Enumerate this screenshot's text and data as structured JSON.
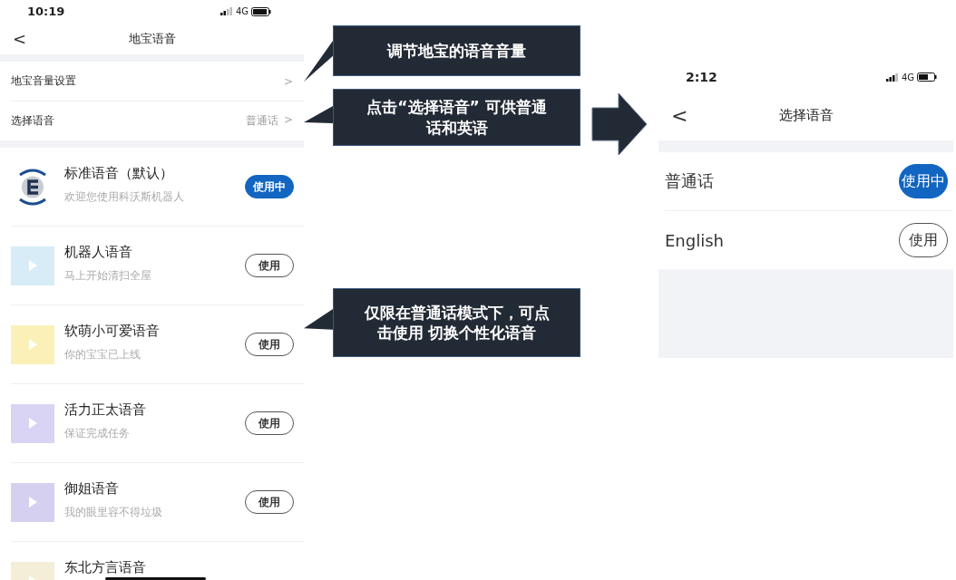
{
  "left_phone": {
    "status_bar": {
      "time": "10:19",
      "network": "4G"
    },
    "nav_bar": {
      "back": "<",
      "title": "地宝语音"
    },
    "settings": [
      {
        "label": "地宝音量设置",
        "chevron": ">"
      },
      {
        "label": "选择语音",
        "value": "普通话",
        "chevron": ">"
      }
    ],
    "voices": [
      {
        "kind": "logo",
        "title": "标准语音（默认）",
        "subtitle": "欢迎您使用科沃斯机器人",
        "button": "使用中",
        "selected": true
      },
      {
        "kind": "picture",
        "title": "机器人语音",
        "subtitle": "马上开始清扫全屋",
        "button": "使用",
        "selected": false
      },
      {
        "kind": "picture",
        "title": "软萌小可爱语音",
        "subtitle": "你的宝宝已上线",
        "button": "使用",
        "selected": false
      },
      {
        "kind": "picture",
        "title": "活力正太语音",
        "subtitle": "保证完成任务",
        "button": "使用",
        "selected": false
      },
      {
        "kind": "picture",
        "title": "御姐语音",
        "subtitle": "我的眼里容不得垃圾",
        "button": "使用",
        "selected": false
      },
      {
        "kind": "picture",
        "title": "东北方言语音"
      }
    ]
  },
  "callouts": [
    "调节地宝的语音音量",
    "点击“选择语音” 可供普通话和英语",
    "仅限在普通话模式下，可点击使用 切换个性化语音"
  ],
  "right_phone": {
    "status_bar": {
      "time": "2:12",
      "network": "4G"
    },
    "nav_bar": {
      "back": "<",
      "title": "选择语音"
    },
    "languages": [
      {
        "label": "普通话",
        "button": "使用中",
        "selected": true
      },
      {
        "label": "English",
        "button": "使用",
        "selected": false
      }
    ]
  }
}
